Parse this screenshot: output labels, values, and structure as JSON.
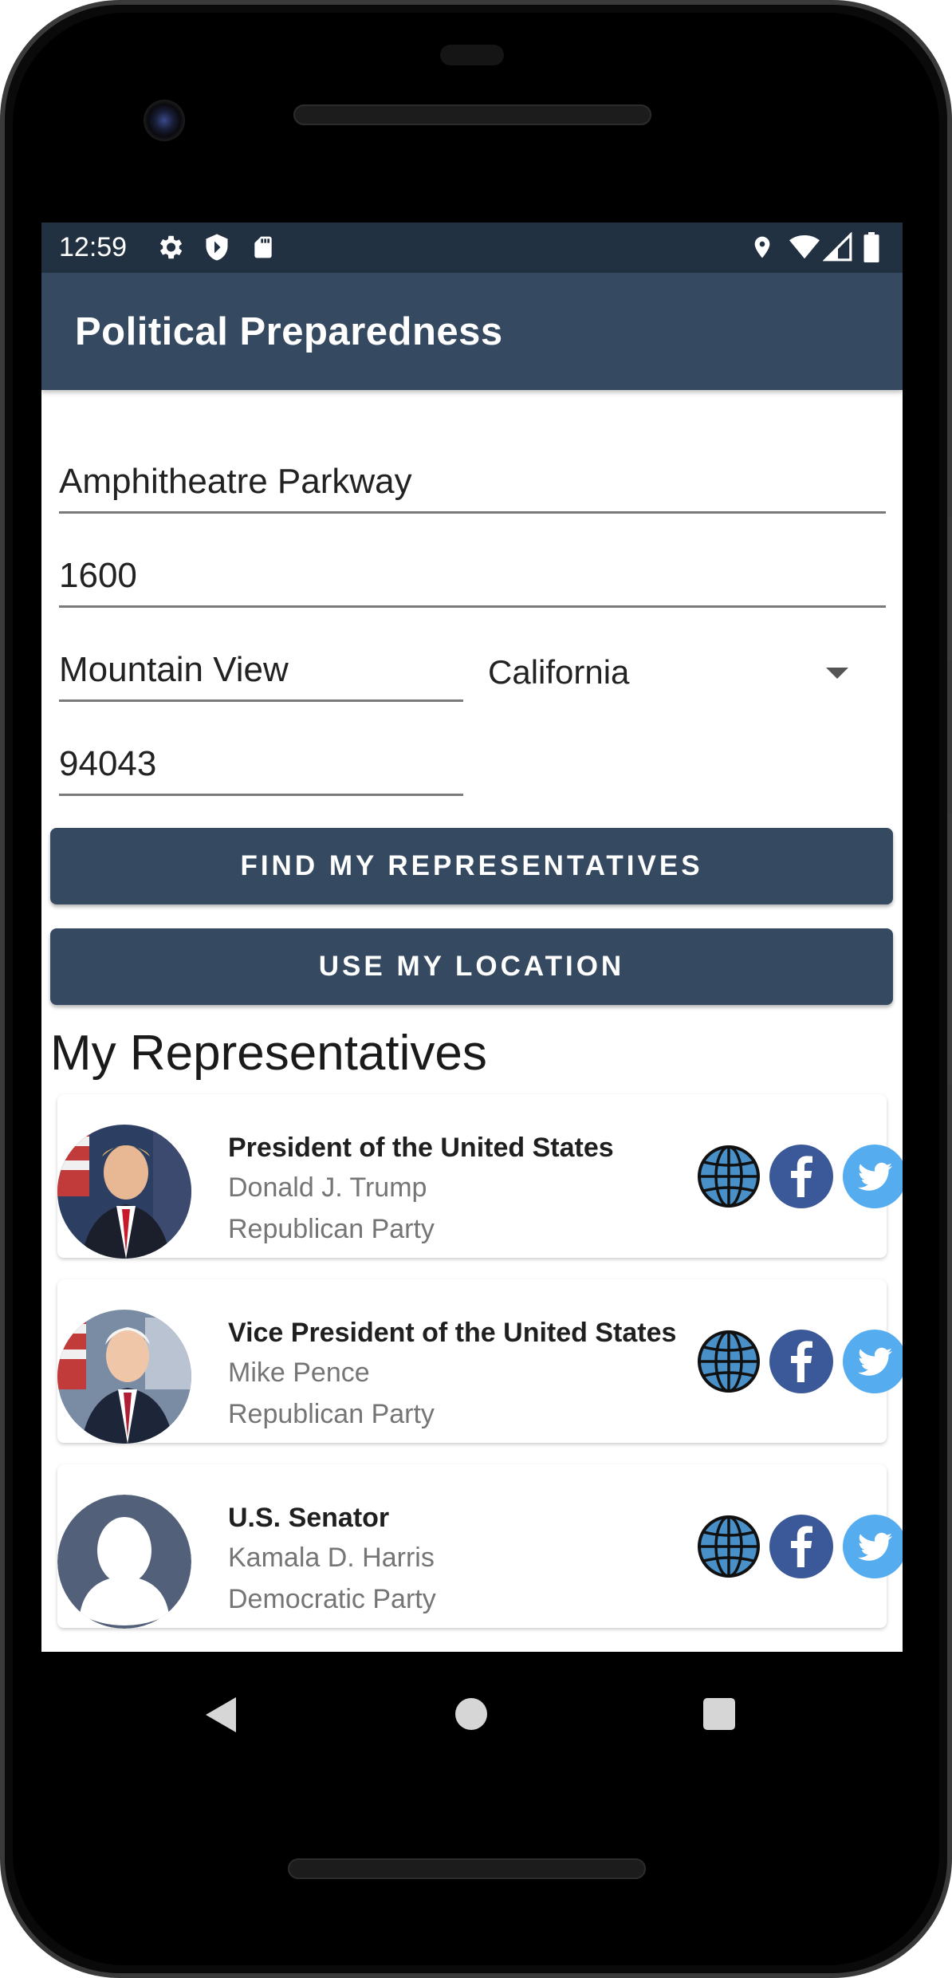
{
  "status_bar": {
    "time": "12:59",
    "left_icons": [
      "settings-icon",
      "shield-icon",
      "sd-card-icon"
    ],
    "right_icons": [
      "location-pin-icon",
      "wifi-icon",
      "signal-icon",
      "battery-icon"
    ]
  },
  "app_bar": {
    "title": "Political Preparedness"
  },
  "form": {
    "address_line_1": "Amphitheatre Parkway",
    "address_line_2": "1600",
    "city": "Mountain View",
    "state": "California",
    "zip": "94043"
  },
  "buttons": {
    "find": "FIND MY REPRESENTATIVES",
    "location": "USE MY LOCATION"
  },
  "section_title": "My Representatives",
  "representatives": [
    {
      "office": "President of the United States",
      "name": "Donald J. Trump",
      "party": "Republican Party",
      "photo": "official-portrait",
      "links": [
        "globe-icon",
        "facebook-icon",
        "twitter-icon"
      ]
    },
    {
      "office": "Vice President of the United States",
      "name": "Mike Pence",
      "party": "Republican Party",
      "photo": "official-portrait",
      "links": [
        "globe-icon",
        "facebook-icon",
        "twitter-icon"
      ]
    },
    {
      "office": "U.S. Senator",
      "name": "Kamala D. Harris",
      "party": "Democratic Party",
      "photo": "default-profile",
      "links": [
        "globe-icon",
        "facebook-icon",
        "twitter-icon"
      ]
    }
  ],
  "nav_bar": [
    "back-icon",
    "home-icon",
    "recents-icon"
  ],
  "colors": {
    "primary": "#354a61",
    "status_bar": "#213141",
    "facebook": "#3b5998",
    "twitter": "#55acee",
    "globe": "#4a90c8"
  }
}
